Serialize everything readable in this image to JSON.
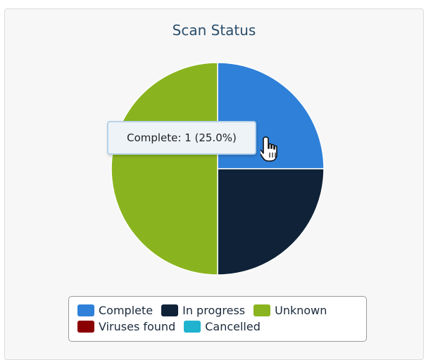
{
  "chart_data": {
    "type": "pie",
    "title": "Scan Status",
    "categories": [
      "Complete",
      "In progress",
      "Unknown",
      "Viruses found",
      "Cancelled"
    ],
    "values": [
      1,
      1,
      2,
      0,
      0
    ],
    "colors": [
      "#2f80d8",
      "#0f2238",
      "#8ab41f",
      "#8b0000",
      "#1fb3cf"
    ],
    "legend_position": "bottom",
    "tooltip": "Complete: 1 (25.0%)"
  },
  "cursor": {
    "icon": "hand-pointer-icon"
  }
}
